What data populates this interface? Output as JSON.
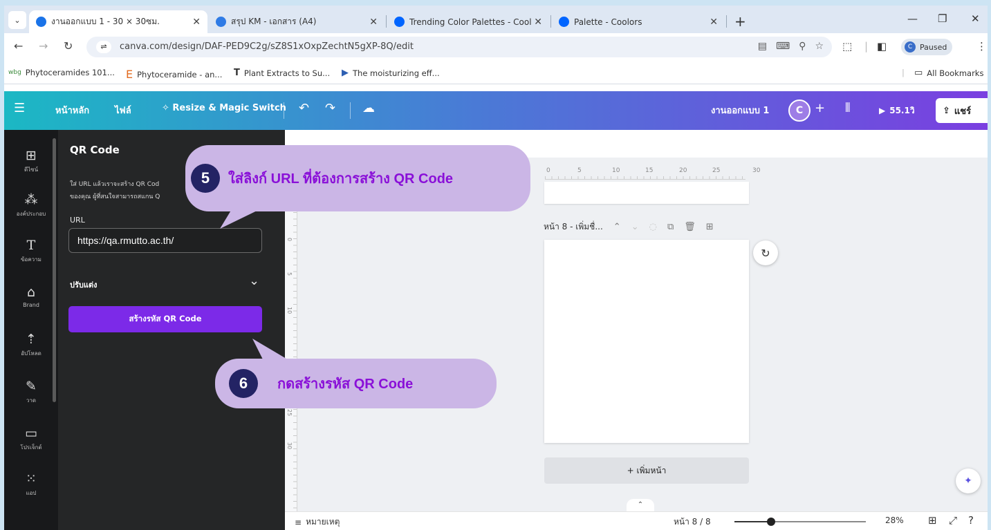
{
  "browser": {
    "tabs": [
      {
        "title": "งานออกแบบ 1 - 30 × 30ซม.",
        "active": true
      },
      {
        "title": "สรุป KM - เอกสาร (A4)",
        "active": false
      },
      {
        "title": "Trending Color Palettes - Coolo",
        "active": false
      },
      {
        "title": "Palette - Coolors",
        "active": false
      }
    ],
    "url": "canva.com/design/DAF-PED9C2g/sZ8S1xOxpZechtN5gXP-8Q/edit",
    "profile_label": "Paused",
    "profile_initial": "C",
    "bookmarks": [
      "Phytoceramides 101...",
      "Phytoceramide - an...",
      "Plant Extracts to Su...",
      "The moisturizing eff..."
    ],
    "all_bookmarks": "All Bookmarks"
  },
  "canva": {
    "nav": {
      "home": "หน้าหลัก",
      "file": "ไฟล์",
      "resize": "Resize & Magic Switch",
      "design_title": "งานออกแบบ 1",
      "avatar_initial": "C",
      "timer": "55.1วิ",
      "share": "แชร์"
    },
    "rail": [
      {
        "icon": "design-icon",
        "label": "ดีไซน์"
      },
      {
        "icon": "elements-icon",
        "label": "องค์ประกอบ"
      },
      {
        "icon": "text-icon",
        "label": "ข้อความ"
      },
      {
        "icon": "brand-icon",
        "label": "Brand"
      },
      {
        "icon": "upload-icon",
        "label": "อัปโหลด"
      },
      {
        "icon": "draw-icon",
        "label": "วาด"
      },
      {
        "icon": "projects-icon",
        "label": "โปรเจ็กต์"
      },
      {
        "icon": "apps-icon",
        "label": "แอป"
      }
    ],
    "panel": {
      "title": "QR Code",
      "desc_line1": "ใส่ URL แล้วเราจะสร้าง QR Cod",
      "desc_line2": "ของคุณ ผู้ที่สนใจสามารถสแกน Q",
      "url_label": "URL",
      "url_value": "https://qa.rmutto.ac.th/",
      "adjust_label": "ปรับแต่ง",
      "generate_button": "สร้างรหัส QR Code"
    },
    "editor": {
      "ruler_marks": [
        "0",
        "5",
        "10",
        "15",
        "20",
        "25",
        "30"
      ],
      "ruler_v_marks": [
        "5",
        "0",
        "5",
        "10",
        "25",
        "30"
      ],
      "page_header": "หน้า 8 - เพิ่มชื่...",
      "add_page": "+ เพิ่มหน้า",
      "notes": "หมายเหตุ",
      "pager": "หน้า 8 / 8",
      "zoom": "28%",
      "zoom_fraction": 0.28
    }
  },
  "callouts": [
    {
      "num": "5",
      "text": "ใส่ลิงก์ URL ที่ต้องการสร้าง QR Code"
    },
    {
      "num": "6",
      "text": "กดสร้างรหัส QR Code"
    }
  ],
  "colors": {
    "callout_bg": "#cbb6e6",
    "callout_text": "#8a10d8",
    "callout_badge": "#232364",
    "primary_button": "#7c2ae8"
  }
}
